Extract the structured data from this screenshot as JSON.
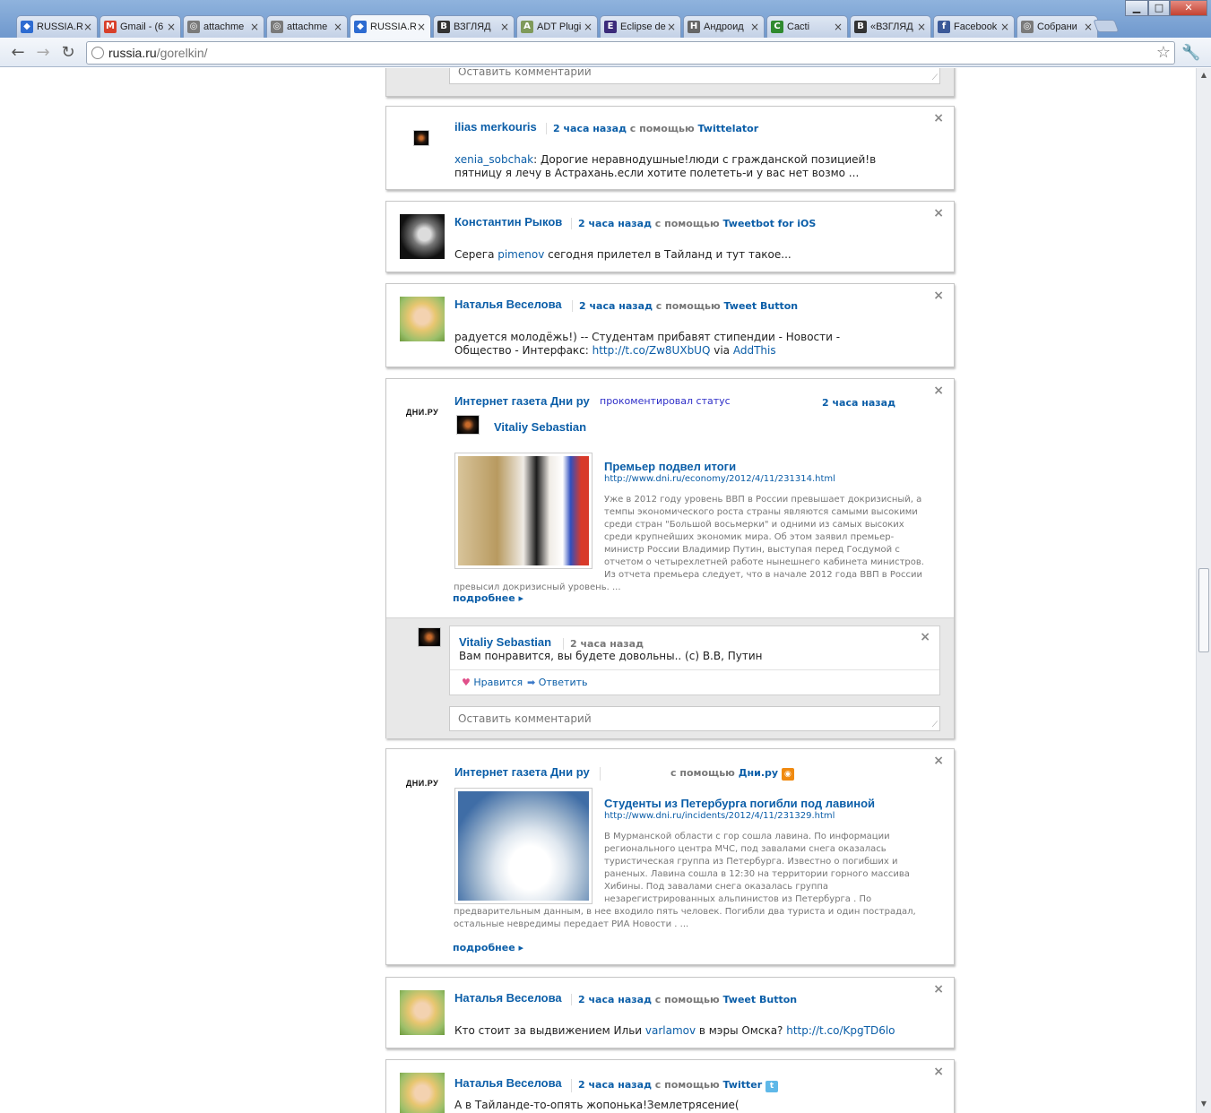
{
  "browser": {
    "tabs": [
      {
        "title": "RUSSIA.R",
        "color": "#2d6bd1",
        "glyph": "◆",
        "active": false
      },
      {
        "title": "Gmail - (6",
        "color": "#d8402b",
        "glyph": "M",
        "active": false
      },
      {
        "title": "attachme",
        "color": "#7a7a7a",
        "glyph": "◎",
        "active": false
      },
      {
        "title": "attachme",
        "color": "#7a7a7a",
        "glyph": "◎",
        "active": false
      },
      {
        "title": "RUSSIA.R",
        "color": "#2d6bd1",
        "glyph": "◆",
        "active": true
      },
      {
        "title": "ВЗГЛЯД",
        "color": "#333333",
        "glyph": "B",
        "active": false
      },
      {
        "title": "ADT Plugi",
        "color": "#7f9a5a",
        "glyph": "A",
        "active": false
      },
      {
        "title": "Eclipse de",
        "color": "#3b2a7a",
        "glyph": "E",
        "active": false
      },
      {
        "title": "Андроид",
        "color": "#666666",
        "glyph": "H",
        "active": false
      },
      {
        "title": "Cacti",
        "color": "#2f8a2f",
        "glyph": "C",
        "active": false
      },
      {
        "title": "«ВЗГЛЯД",
        "color": "#333333",
        "glyph": "B",
        "active": false
      },
      {
        "title": "Facebook",
        "color": "#3b5998",
        "glyph": "f",
        "active": false
      },
      {
        "title": "Собрани",
        "color": "#7a7a7a",
        "glyph": "◎",
        "active": false
      }
    ],
    "url_host": "russia.ru",
    "url_path": "/gorelkin/"
  },
  "feed": {
    "comment_placeholder": "Оставить комментарий",
    "posts": [
      {
        "author": "ilias merkouris",
        "time": "2 часа назад",
        "via_prefix": "с помощью",
        "source": "Twittelator",
        "mention": "xenia_sobchak",
        "text": ": Дорогие неравнодушные!люди с гражданской позицией!в пятницу я лечу в Астрахань.если хотите полететь-и у вас нет возмо ..."
      },
      {
        "author": "Константин Рыков",
        "time": "2 часа назад",
        "via_prefix": "с помощью",
        "source": "Tweetbot for iOS",
        "text_before": "Серега ",
        "mention": "pimenov",
        "text_after": " сегодня прилетел в Тайланд и тут такое..."
      },
      {
        "author": "Наталья Веселова",
        "time": "2 часа назад",
        "via_prefix": "с помощью",
        "source": "Tweet Button",
        "text_before": "радуется молодёжь!) -- Студентам прибавят стипендии - Новости - Общество - Интерфакс: ",
        "link": "http://t.co/Zw8UXbUQ",
        "text_mid": " via ",
        "link2": "AddThis"
      },
      {
        "author": "Интернет газета Дни ру",
        "logo": "ДНИ.РУ",
        "action": "прокоментировал статус",
        "time": "2 часа назад",
        "sub_author": "Vitaliy Sebastian",
        "article_title": "Премьер подвел итоги",
        "article_url": "http://www.dni.ru/economy/2012/4/11/231314.html",
        "article_text": "Уже в 2012 году уровень ВВП в России превышает докризисный, а темпы экономического роста страны являются самыми высокими среди стран \"Большой восьмерки\" и одними из самых высоких среди крупнейших экономик мира. Об этом заявил премьер-министр России Владимир Путин, выступая перед Госдумой с отчетом о четырехлетней работе нынешнего кабинета министров. Из отчета премьера следует, что в начале 2012 года ВВП в России превысил докризисный уровень. ...",
        "more": "подробнее",
        "reply": {
          "author": "Vitaliy Sebastian",
          "time": "2 часа назад",
          "text": "Вам понравится, вы будете довольны.. (с) В.В, Путин",
          "like": "Нравится",
          "answer": "Ответить"
        }
      },
      {
        "author": "Интернет газета Дни ру",
        "logo": "ДНИ.РУ",
        "via_prefix": "с помощью",
        "source": "Дни.ру",
        "article_title": "Студенты из Петербурга погибли под лавиной",
        "article_url": "http://www.dni.ru/incidents/2012/4/11/231329.html",
        "article_text": "В Мурманской области с гор сошла лавина. По информации регионального центра МЧС, под завалами снега оказалась туристическая группа из Петербурга. Известно о погибших и раненых. Лавина сошла в 12:30 на территории горного массива Хибины. Под завалами снега оказалась группа незарегистрированных альпинистов из Петербурга . По предварительным данным, в нее входило пять человек. Погибли два туриста и один пострадал, остальные невредимы передает РИА Новости . ...",
        "more": "подробнее"
      },
      {
        "author": "Наталья Веселова",
        "time": "2 часа назад",
        "via_prefix": "с помощью",
        "source": "Tweet Button",
        "text_before": "Кто стоит за выдвижением Ильи ",
        "mention": "varlamov",
        "text_mid": " в мэры Омска? ",
        "link": "http://t.co/KpgTD6lo"
      },
      {
        "author": "Наталья Веселова",
        "time": "2 часа назад",
        "via_prefix": "с помощью",
        "source": "Twitter",
        "text": "А в Тайланде-то-опять жопонька!Землетрясение("
      }
    ]
  },
  "colors": {
    "link": "#0b5ea8",
    "meta_gray": "#777777",
    "subthread_bg": "#e8e8e8"
  }
}
